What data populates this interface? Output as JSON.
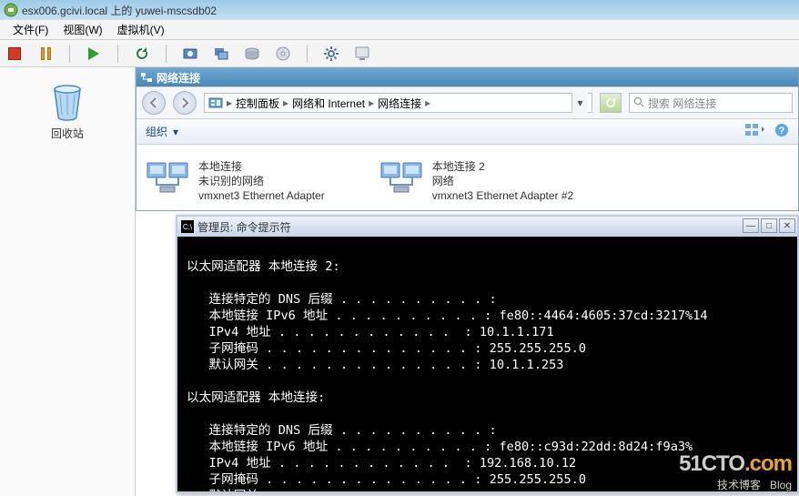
{
  "window": {
    "title": "esx006.gcivi.local 上的 yuwei-mscsdb02"
  },
  "menu": {
    "file": "文件(F)",
    "view": "视图(W)",
    "vm": "虚拟机(V)"
  },
  "desktop": {
    "recycle_label": "回收站"
  },
  "network_window": {
    "title": "网络连接",
    "breadcrumb": {
      "cp": "控制面板",
      "net": "网络和 Internet",
      "conn": "网络连接"
    },
    "search_placeholder": "搜索 网络连接",
    "organize": "组织",
    "connections": [
      {
        "name": "本地连接",
        "status": "未识别的网络",
        "adapter": "vmxnet3 Ethernet Adapter"
      },
      {
        "name": "本地连接 2",
        "status": "网络",
        "adapter": "vmxnet3 Ethernet Adapter #2"
      }
    ]
  },
  "cmd": {
    "title": "管理员: 命令提示符",
    "adapter2_header": "以太网适配器 本地连接 2:",
    "adapter1_header": "以太网适配器 本地连接:",
    "labels": {
      "dns_suffix": "连接特定的 DNS 后缀",
      "link_ipv6": "本地链接 IPv6 地址",
      "ipv4": "IPv4 地址",
      "subnet": "子网掩码",
      "gateway": "默认网关"
    },
    "adapter2": {
      "dns_suffix": "",
      "link_ipv6": "fe80::4464:4605:37cd:3217%14",
      "ipv4": "10.1.1.171",
      "subnet": "255.255.255.0",
      "gateway": "10.1.1.253"
    },
    "adapter1": {
      "dns_suffix": "",
      "link_ipv6": "fe80::c93d:22dd:8d24:f9a3%",
      "ipv4": "192.168.10.12",
      "subnet": "255.255.255.0",
      "gateway": ""
    }
  },
  "watermark": {
    "site": "51CTO",
    "dotcom": ".com",
    "sub": "技术博客",
    "blog": "Blog"
  }
}
